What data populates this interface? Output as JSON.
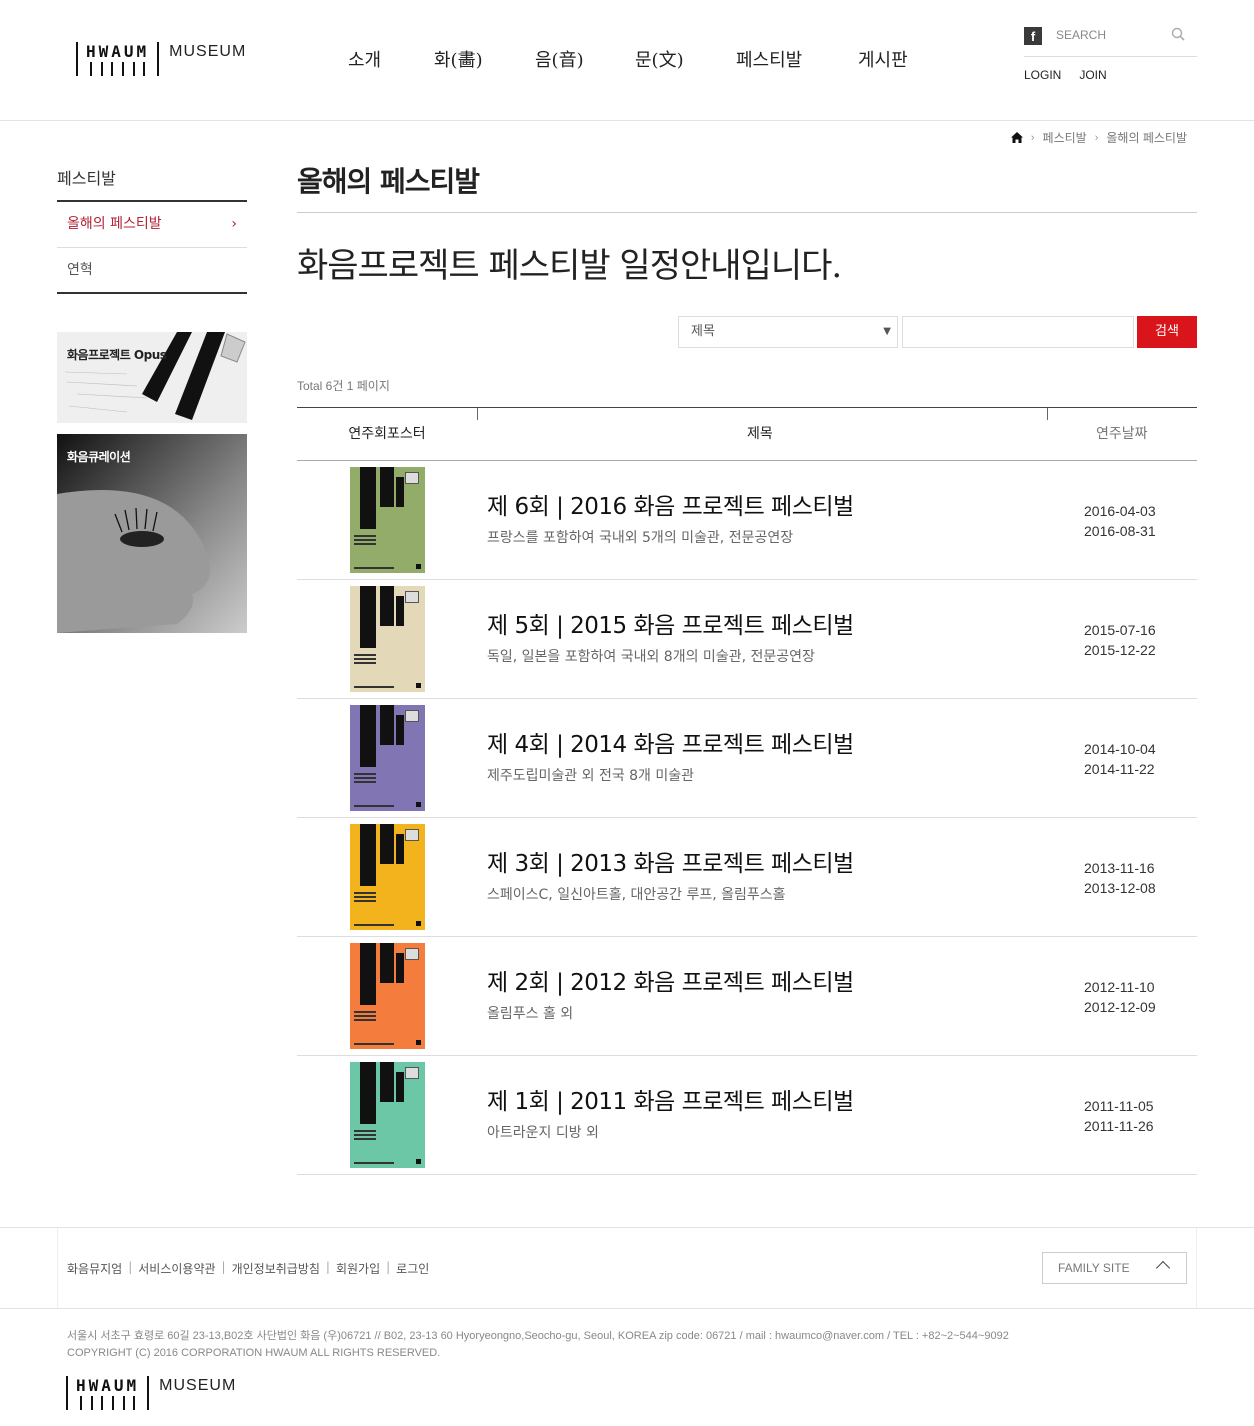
{
  "header": {
    "logo_word": "HWAUM",
    "logo_museum": "MUSEUM",
    "nav": [
      "소개",
      "화(畵)",
      "음(音)",
      "문(文)",
      "페스티발",
      "게시판"
    ],
    "search_placeholder": "SEARCH",
    "facebook": "f",
    "login": "LOGIN",
    "join": "JOIN"
  },
  "breadcrumb": [
    "페스티발",
    "올해의 페스티발"
  ],
  "sidebar": {
    "title": "페스티발",
    "items": [
      {
        "label": "올해의 페스티발",
        "active": true
      },
      {
        "label": "연혁",
        "active": false
      }
    ],
    "banners": [
      {
        "label": "화음프로젝트 Opus"
      },
      {
        "label": "화음큐레이션"
      }
    ]
  },
  "main": {
    "title": "올해의 페스티발",
    "lead": "화음프로젝트 페스티발 일정안내입니다.",
    "search": {
      "select_value": "제목",
      "input_value": "",
      "button": "검색"
    },
    "total": "Total 6건 1 페이지",
    "columns": [
      "연주회포스터",
      "제목",
      "연주날짜"
    ],
    "rows": [
      {
        "title": "제 6회 | 2016 화음 프로젝트 페스티벌",
        "subtitle": "프랑스를 포함하여 국내외 5개의 미술관, 전문공연장",
        "start": "2016-04-03",
        "end": "2016-08-31",
        "poster_color": "#93ac6a"
      },
      {
        "title": "제 5회 | 2015 화음 프로젝트 페스티벌",
        "subtitle": "독일, 일본을 포함하여 국내외 8개의 미술관, 전문공연장",
        "start": "2015-07-16",
        "end": "2015-12-22",
        "poster_color": "#e3d8b8"
      },
      {
        "title": "제 4회 | 2014 화음 프로젝트 페스티벌",
        "subtitle": "제주도립미술관 외 전국 8개 미술관",
        "start": "2014-10-04",
        "end": "2014-11-22",
        "poster_color": "#8275b3"
      },
      {
        "title": "제 3회 | 2013 화음 프로젝트 페스티벌",
        "subtitle": "스페이스C, 일신아트홀, 대안공간 루프, 올림푸스홀",
        "start": "2013-11-16",
        "end": "2013-12-08",
        "poster_color": "#f3b31c"
      },
      {
        "title": "제 2회 | 2012 화음 프로젝트 페스티벌",
        "subtitle": "올림푸스 홀 외",
        "start": "2012-11-10",
        "end": "2012-12-09",
        "poster_color": "#f47c3c"
      },
      {
        "title": "제 1회 | 2011 화음 프로젝트 페스티벌",
        "subtitle": "아트라운지 디방 외",
        "start": "2011-11-05",
        "end": "2011-11-26",
        "poster_color": "#6cc7a7"
      }
    ]
  },
  "footer": {
    "links": [
      "화음뮤지엄",
      "서비스이용약관",
      "개인정보취급방침",
      "회원가입",
      "로그인"
    ],
    "family_site": "FAMILY SITE",
    "address": "서울시 서초구 효령로 60길 23-13,B02호 사단법인 화음 (우)06721 // B02, 23-13 60 Hyoryeongno,Seocho-gu, Seoul, KOREA zip code: 06721 / mail : hwaumco@naver.com / TEL : +82~2~544~9092",
    "copyright": "COPYRIGHT (C) 2016 CORPORATION HWAUM ALL RIGHTS RESERVED.",
    "logo_word": "HWAUM",
    "logo_museum": "MUSEUM"
  },
  "colors": {
    "accent": "#d9151b",
    "active_menu": "#b22234"
  }
}
